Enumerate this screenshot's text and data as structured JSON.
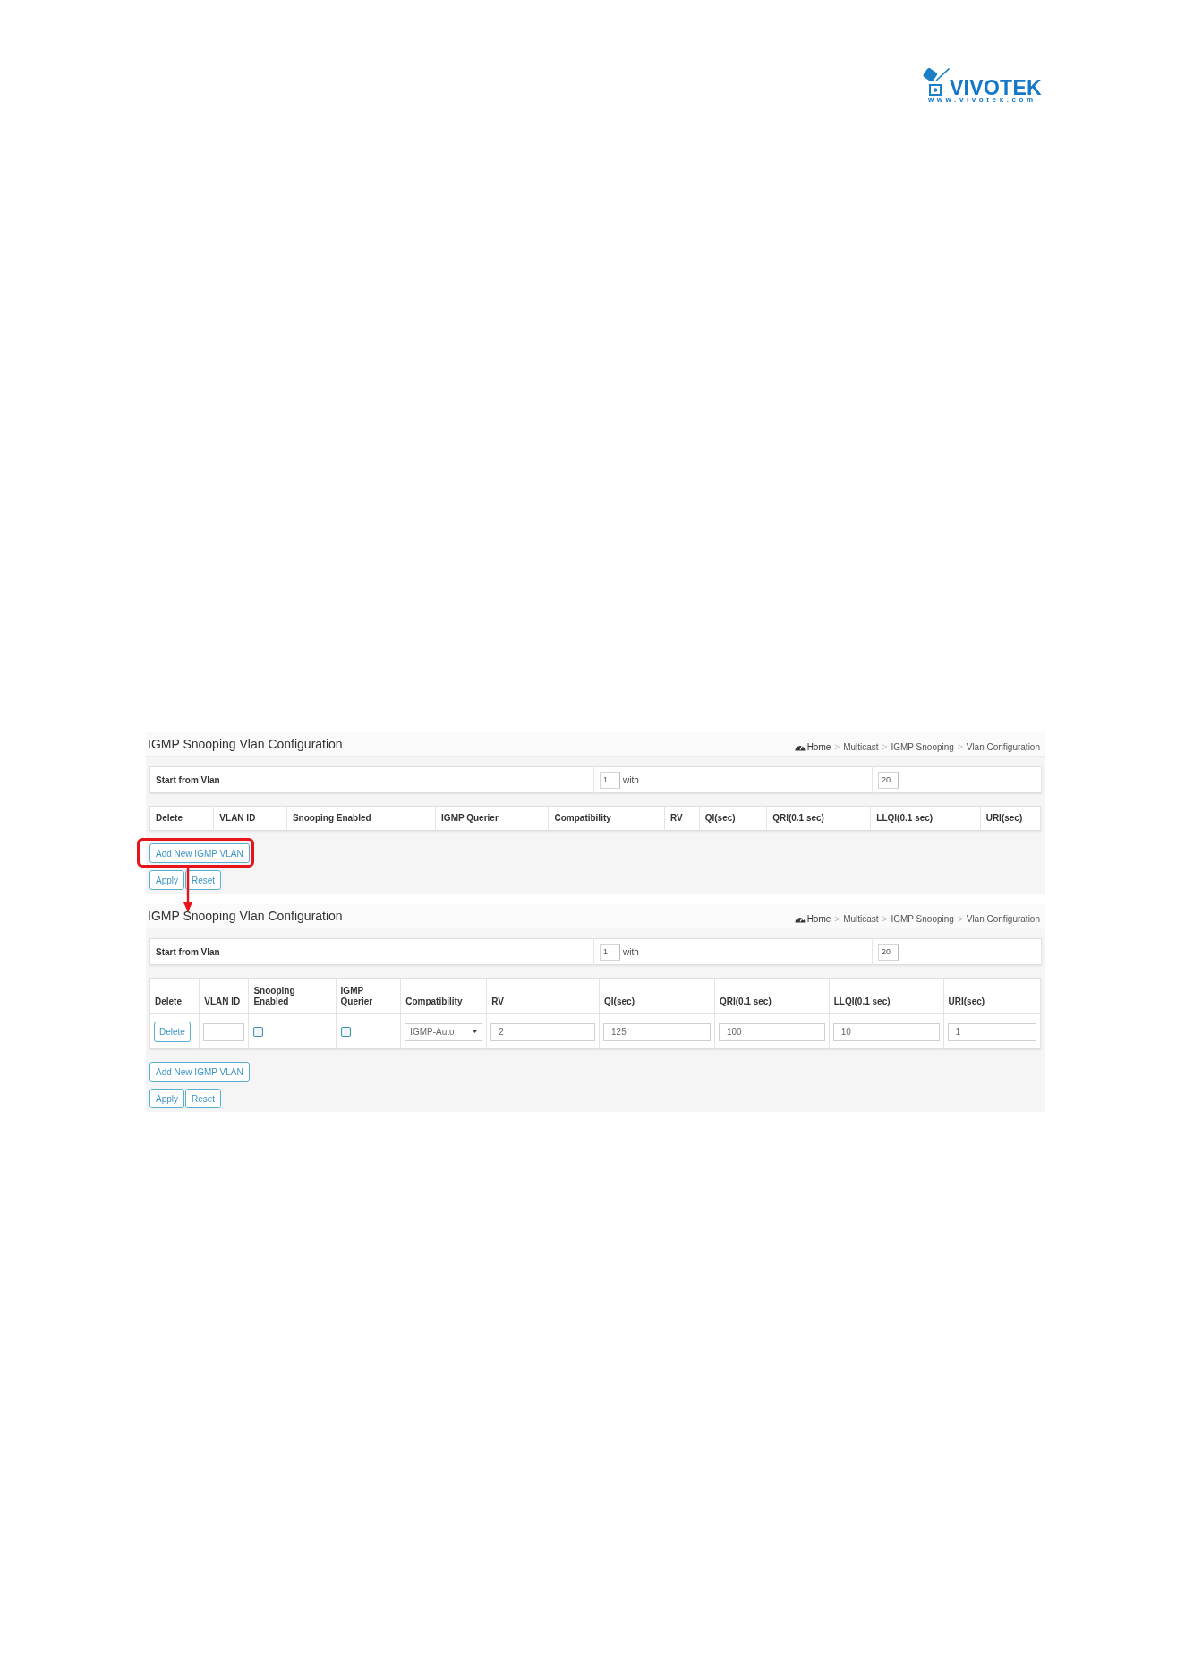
{
  "logo": {
    "wordmark": "VIVOTEK",
    "url": "www.vivotek.com"
  },
  "screens": [
    {
      "title": "IGMP Snooping Vlan Configuration",
      "breadcrumb": {
        "separator": ">",
        "items": [
          "Home",
          "Multicast",
          "IGMP Snooping",
          "Vlan Configuration"
        ]
      },
      "start_from_vlan": {
        "label": "Start from Vlan",
        "start": "1",
        "with_label": "with",
        "count": "20"
      },
      "table": {
        "columns": [
          "Delete",
          "VLAN ID",
          "Snooping Enabled",
          "IGMP Querier",
          "Compatibility",
          "RV",
          "QI(sec)",
          "QRI(0.1 sec)",
          "LLQI(0.1 sec)",
          "URI(sec)"
        ]
      },
      "add_button": {
        "label": "Add New IGMP VLAN",
        "highlighted": true
      },
      "apply_button": {
        "label": "Apply"
      },
      "reset_button": {
        "label": "Reset"
      }
    },
    {
      "title": "IGMP Snooping Vlan Configuration",
      "breadcrumb": {
        "separator": ">",
        "items": [
          "Home",
          "Multicast",
          "IGMP Snooping",
          "Vlan Configuration"
        ]
      },
      "start_from_vlan": {
        "label": "Start from Vlan",
        "start": "1",
        "with_label": "with",
        "count": "20"
      },
      "table": {
        "columns": [
          "Delete",
          "VLAN ID",
          "Snooping Enabled",
          "IGMP Querier",
          "Compatibility",
          "RV",
          "QI(sec)",
          "QRI(0.1 sec)",
          "LLQI(0.1 sec)",
          "URI(sec)"
        ],
        "rows": [
          {
            "cells": [
              {
                "kind": "button",
                "label": "Delete"
              },
              {
                "kind": "input"
              },
              {
                "kind": "checkbox",
                "checked": false
              },
              {
                "kind": "checkbox",
                "checked": false
              },
              {
                "kind": "select",
                "value": "IGMP-Auto"
              },
              {
                "kind": "input",
                "value": "2"
              },
              {
                "kind": "input",
                "value": "125"
              },
              {
                "kind": "input",
                "value": "100"
              },
              {
                "kind": "input",
                "value": "10"
              },
              {
                "kind": "input",
                "value": "1"
              }
            ]
          }
        ]
      },
      "add_button": {
        "label": "Add New IGMP VLAN",
        "highlighted": false
      },
      "apply_button": {
        "label": "Apply"
      },
      "reset_button": {
        "label": "Reset"
      }
    }
  ]
}
